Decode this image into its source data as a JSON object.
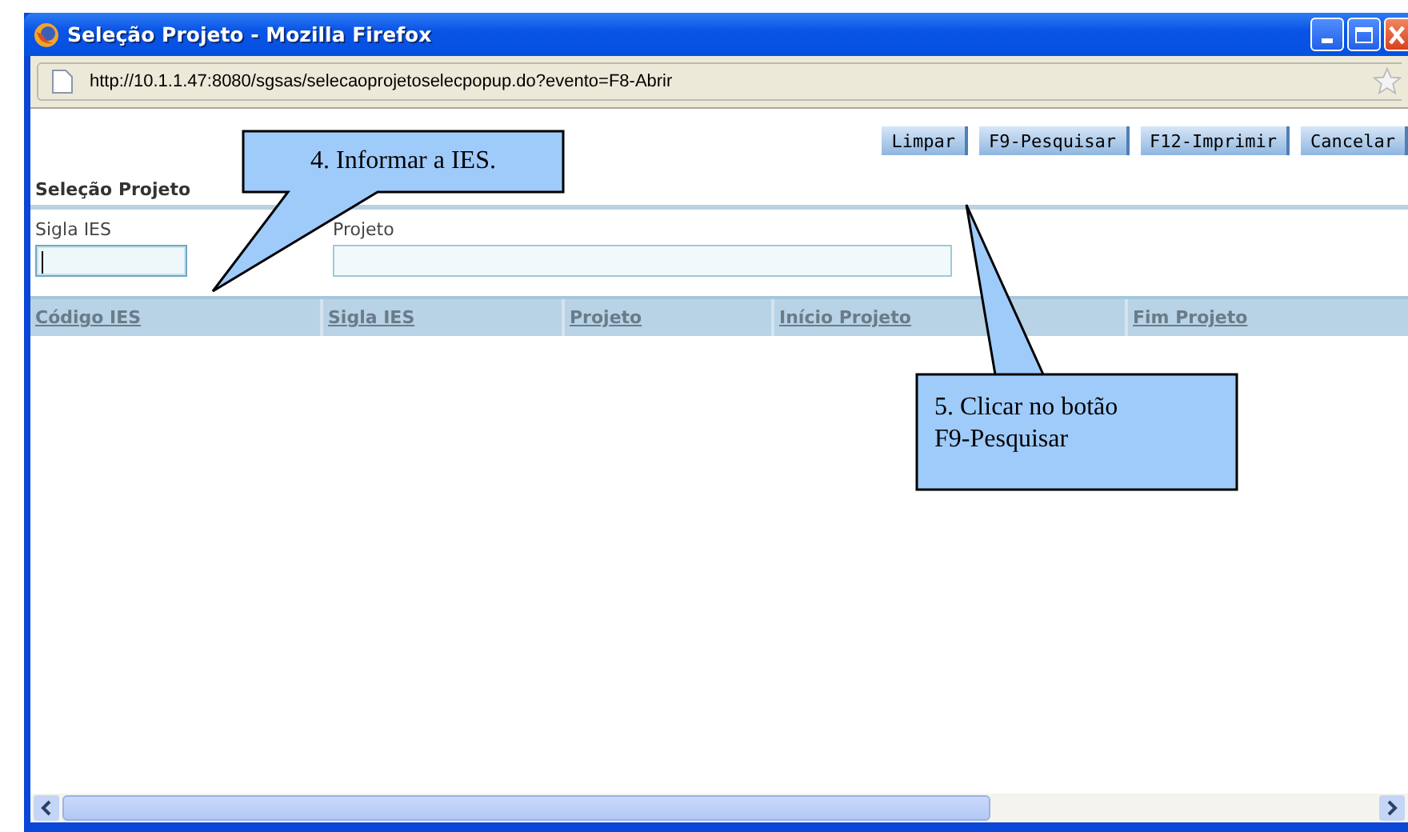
{
  "window": {
    "title": "Seleção Projeto - Mozilla Firefox"
  },
  "address_bar": {
    "url": "http://10.1.1.47:8080/sgsas/selecaoprojetoselecpopup.do?evento=F8-Abrir"
  },
  "buttons": [
    "Limpar",
    "F9-Pesquisar",
    "F12-Imprimir",
    "Cancelar"
  ],
  "section_title": "Seleção Projeto",
  "fields": [
    {
      "label": "Sigla IES",
      "focused": true
    },
    {
      "label": "Projeto",
      "focused": false
    }
  ],
  "table": {
    "columns": [
      "Código IES",
      "Sigla IES",
      "Projeto",
      "Início Projeto",
      "Fim Projeto"
    ]
  },
  "callouts": [
    {
      "text": "4. Informar a IES."
    },
    {
      "text": "5. Clicar no botão F9-Pesquisar"
    }
  ]
}
